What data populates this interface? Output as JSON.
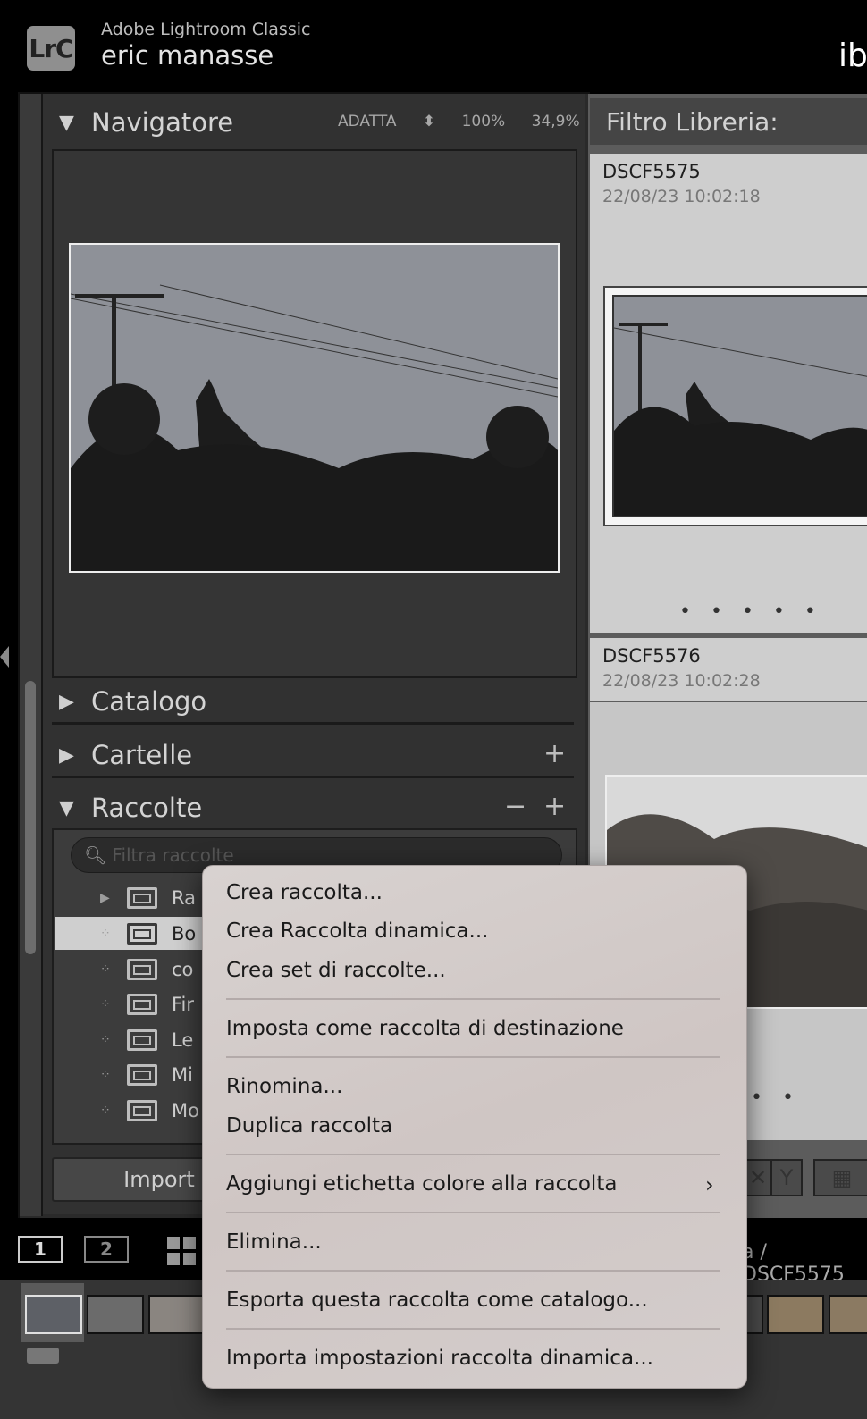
{
  "header": {
    "logo_text": "LrC",
    "app_name": "Adobe Lightroom Classic",
    "user_name": "eric manasse",
    "module_tab_partial": "ib"
  },
  "navigator": {
    "title": "Navigatore",
    "fit_label": "ADATTA",
    "zoom_100": "100%",
    "zoom_custom": "34,9%"
  },
  "panels": {
    "catalog": "Catalogo",
    "folders": "Cartelle",
    "collections": "Raccolte"
  },
  "collections": {
    "search_placeholder": "Filtra raccolte",
    "items": [
      {
        "label": "Ra",
        "type": "set"
      },
      {
        "label": "Bo",
        "type": "collection",
        "selected": true
      },
      {
        "label": "co",
        "type": "collection"
      },
      {
        "label": "Fir",
        "type": "collection"
      },
      {
        "label": "Le",
        "type": "collection"
      },
      {
        "label": "Mi",
        "type": "collection"
      },
      {
        "label": "Mo",
        "type": "collection"
      }
    ]
  },
  "import_button": "Import",
  "grid": {
    "filter_label": "Filtro Libreria:",
    "cells": [
      {
        "name": "DSCF5575",
        "date": "22/08/23 10:02:18"
      },
      {
        "name": "DSCF5576",
        "date": "22/08/23 10:02:28"
      }
    ]
  },
  "bottom": {
    "page1": "1",
    "page2": "2",
    "path": "a / DSCF5575"
  },
  "context_menu": {
    "items": [
      "Crea raccolta...",
      "Crea Raccolta dinamica...",
      "Crea set di raccolte...",
      "Imposta come raccolta di destinazione",
      "Rinomina...",
      "Duplica raccolta",
      "Aggiungi etichetta colore alla raccolta",
      "Elimina...",
      "Esporta questa raccolta come catalogo...",
      "Importa impostazioni raccolta dinamica..."
    ]
  },
  "colors": {
    "accent_selected_row": "#cfcfcf",
    "menu_bg": "#d4cdcc"
  }
}
